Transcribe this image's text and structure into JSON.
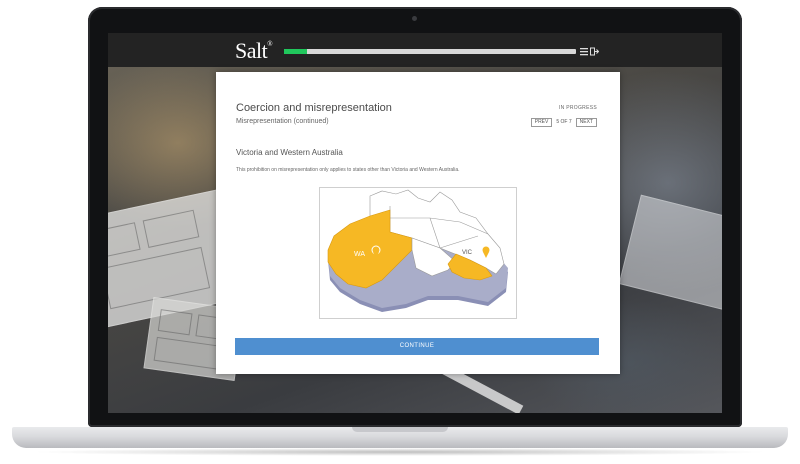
{
  "app": {
    "logo": "Salt",
    "logo_mark": "®",
    "progress_fraction": 0.08
  },
  "header": {
    "menu_icon": "menu-icon",
    "exit_icon": "exit-icon"
  },
  "lesson": {
    "title": "Coercion and misrepresentation",
    "subtitle": "Misrepresentation (continued)",
    "status": "IN PROGRESS",
    "prev_label": "PREV",
    "page_count": "5 OF 7",
    "next_label": "NEXT",
    "section_heading": "Victoria and Western Australia",
    "body": "This prohibition on misrepresentation only applies to states other than Victoria and Western Australia.",
    "continue_label": "CONTINUE"
  },
  "map": {
    "label_wa": "WA",
    "label_vic": "VIC",
    "highlight_color": "#f6b824",
    "pin_icon": "map-pin-icon"
  }
}
